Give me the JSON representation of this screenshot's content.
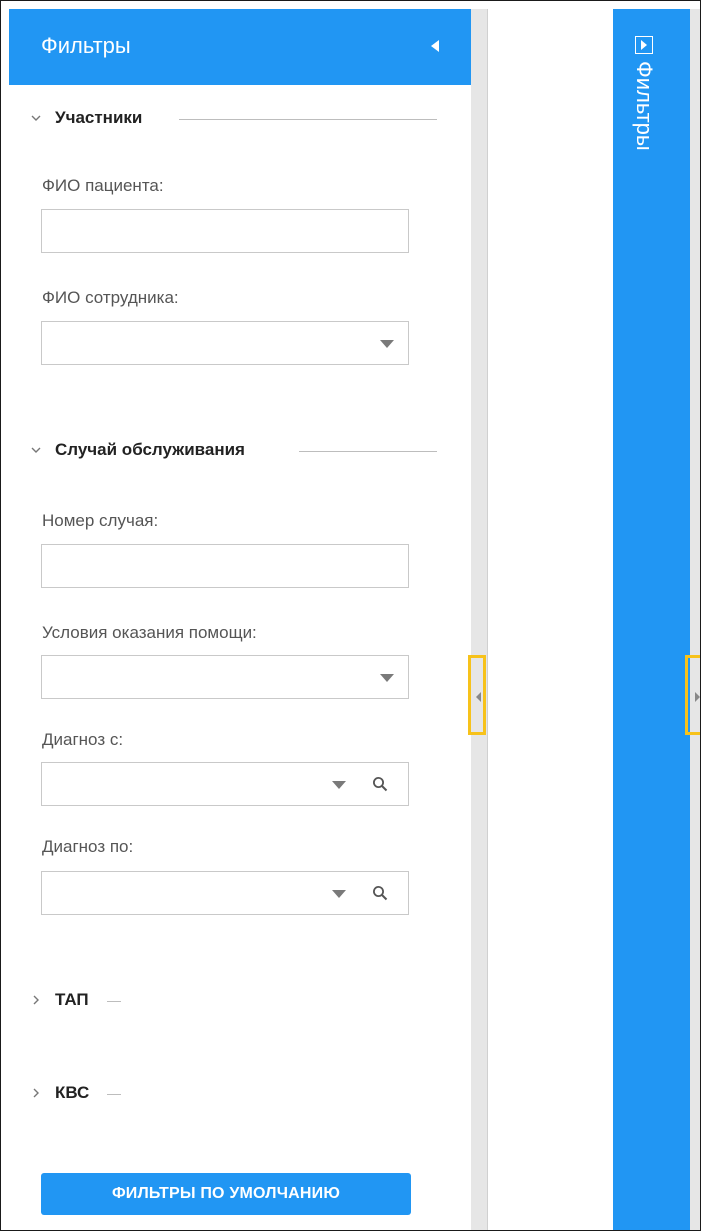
{
  "panel": {
    "title": "Фильтры",
    "collapse_icon": "triangle-left-icon"
  },
  "sections": {
    "participants": {
      "title": "Участники",
      "expanded": true,
      "patient_label": "ФИО пациента:",
      "patient_value": "",
      "employee_label": "ФИО сотрудника:",
      "employee_value": ""
    },
    "service_case": {
      "title": "Случай обслуживания",
      "expanded": true,
      "case_number_label": "Номер случая:",
      "case_number_value": "",
      "care_conditions_label": "Условия оказания помощи:",
      "care_conditions_value": "",
      "diagnosis_from_label": "Диагноз с:",
      "diagnosis_from_value": "",
      "diagnosis_to_label": "Диагноз по:",
      "diagnosis_to_value": ""
    },
    "tap": {
      "title": "ТАП",
      "expanded": false
    },
    "kvs": {
      "title": "КВС",
      "expanded": false
    }
  },
  "default_filters_button": "ФИЛЬТРЫ ПО УМОЛЧАНИЮ",
  "collapsed_panel": {
    "title": "Фильтры",
    "expand_icon": "triangle-right-icon"
  },
  "colors": {
    "accent": "#2196f3",
    "handle_highlight": "#f7c21a",
    "splitter": "#e6e6e6"
  }
}
